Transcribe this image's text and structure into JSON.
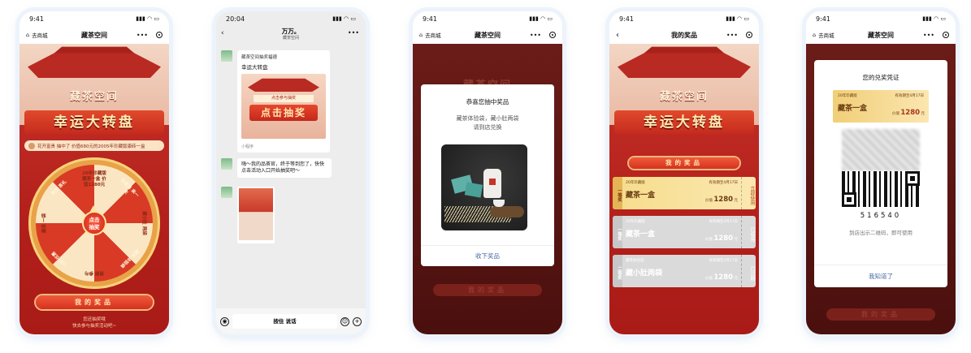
{
  "screen1": {
    "time": "9:41",
    "back_label": "去商城",
    "nav_title": "藏茶空间",
    "brand": "藏茶空间",
    "hero_title": "幸运大转盘",
    "ticker_text": "花开富贵 抽中了 价值680元的2005年珍藏版康砖一盒",
    "wheel_segments": [
      "20年珍藏版 藏茶一盒 价值1280元",
      "免费再 来一次",
      "藏小肚 两袋",
      "藏茶 体验袋",
      "谢谢 参与",
      "8折 优惠",
      "藏茶 一袋",
      "养生 茶礼"
    ],
    "wheel_center": [
      "点击",
      "抽奖"
    ],
    "prize_button": "我的奖品",
    "footer": [
      "您还抽奖哦",
      "快去参与抽奖活动吧~"
    ]
  },
  "screen2": {
    "time": "20:04",
    "chat_title": "万万。",
    "chat_subtitle": "藏茶空间",
    "card_source": "藏茶空间抽奖福德",
    "card_title": "幸运大转盘",
    "card_sign": "点击参与抽奖",
    "card_cta": "点击抽奖",
    "card_footer": "小程序",
    "message": "嗨～我的品茶官，终于等到您了，快快点击活动入口开始抽奖吧～",
    "input_label": "按住 说话"
  },
  "screen3": {
    "time": "9:41",
    "back_label": "去商城",
    "nav_title": "藏茶空间",
    "modal_title": "恭喜您抽中奖品",
    "modal_desc": "藏茶体验袋，藏小肚两袋",
    "modal_desc2": "请到店兑换",
    "modal_button": "收下奖品",
    "dim_title": "藏茶空间",
    "dim_button": "我的奖品"
  },
  "screen4": {
    "time": "9:41",
    "nav_title": "我的奖品",
    "brand": "藏茶空间",
    "hero_title": "幸运大转盘",
    "section_title": "我的奖品",
    "tickets": [
      {
        "tag": "一等奖",
        "sub_left": "20年珍藏版",
        "sub_right": "有效期至4月17日",
        "name": "藏茶一盒",
        "price_label": "价值",
        "price": "1280",
        "unit": "元",
        "status": "立即使用"
      },
      {
        "tag": "一等奖",
        "sub_left": "20年珍藏版",
        "sub_right": "有效期至4月17日",
        "name": "藏茶一盒",
        "price_label": "价值",
        "price": "1280",
        "unit": "元",
        "status": "已使用"
      },
      {
        "tag": "二等奖",
        "sub_left": "藏茶体验袋",
        "sub_right": "有效期至4月17日",
        "name": "藏小肚两袋",
        "price_label": "价值",
        "price": "1280",
        "unit": "元",
        "status": "已过期"
      }
    ]
  },
  "screen5": {
    "time": "9:41",
    "back_label": "去商城",
    "nav_title": "藏茶空间",
    "voucher_title": "您的兑奖凭证",
    "ticket_sub_left": "20年珍藏版",
    "ticket_sub_right": "有效期至4月17日",
    "ticket_name": "藏茶一盒",
    "ticket_price_label": "价值",
    "ticket_price": "1280",
    "ticket_unit": "元",
    "code": "516540",
    "note": "到店出示二维码，即可使用",
    "button": "我知道了",
    "dim_button": "我的奖品"
  },
  "colors": {
    "accent_red": "#c8322a",
    "gold": "#f6dc8b",
    "link_blue": "#4a6aa4"
  }
}
